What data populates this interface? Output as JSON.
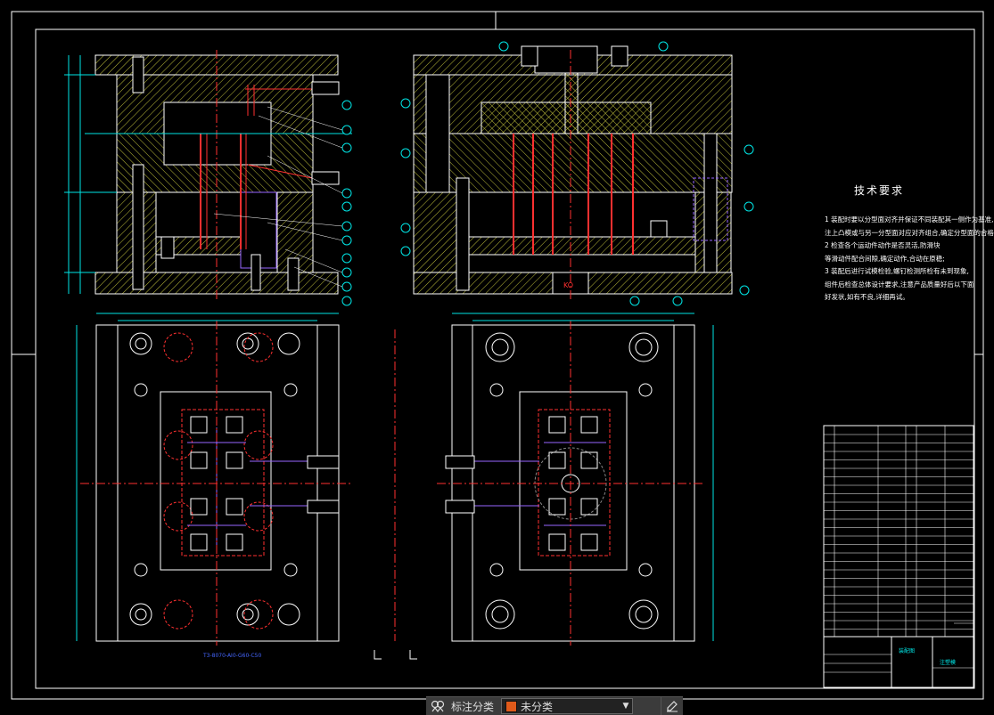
{
  "tech": {
    "title": "技术要求",
    "lines": [
      "1 装配时要以分型面对齐并保证不同装配其一侧作为基准,",
      "注上凸模或与另一分型面对应对齐组合,确定分型面的合格式;",
      "2 检查各个运动件动作是否灵活,防滑块",
      "等滑动件配合间隙,确定动作,合动在原稳;",
      "3 装配后进行试模检验,螺钉检测所检有未到现象,",
      "组件后检查总体设计要求,注意产品质量好后以下面",
      "好发状,如有不良,详细再试。"
    ]
  },
  "labels": {
    "koi": "KO",
    "bottom_left_note": "T3-8070-AI0-G60-C50",
    "title_block_a": "装配图",
    "title_block_b": "注塑模"
  },
  "bottom_bar": {
    "label": "标注分类",
    "selected": "未分类"
  },
  "colors": {
    "background": "#000000",
    "outline": "#ffffff",
    "hatch": "#cfcf40",
    "dimension": "#00e5e5",
    "center": "#ff3030",
    "pin": "#ff3030",
    "water": "#9966ff",
    "accent": "#e05a1a"
  }
}
